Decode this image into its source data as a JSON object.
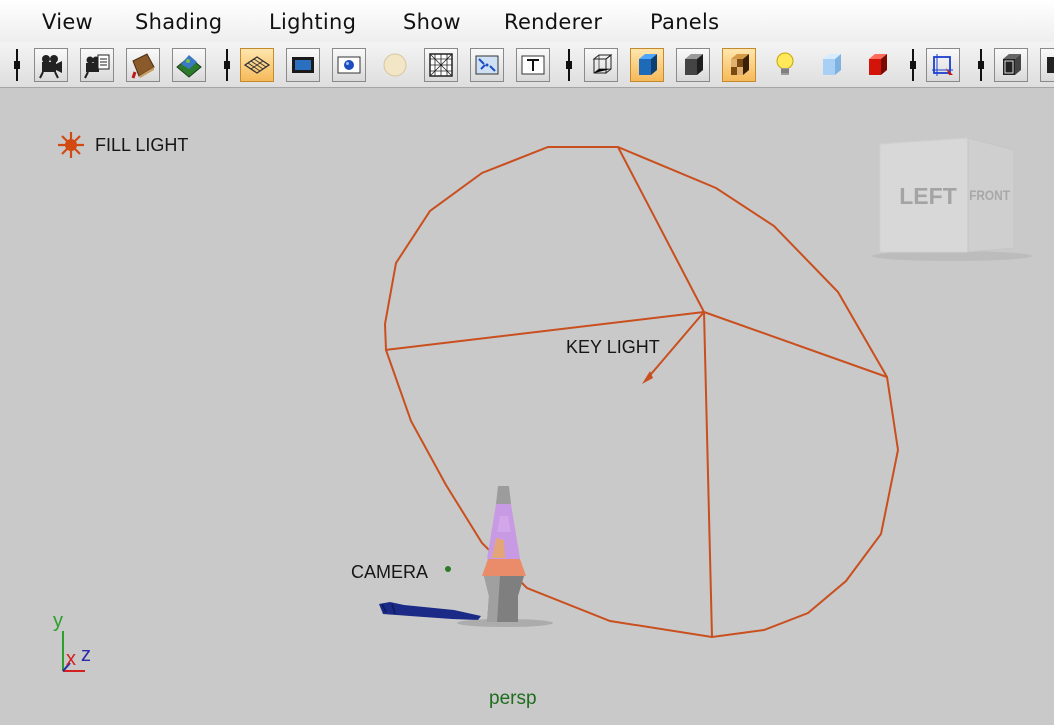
{
  "menu": {
    "items": [
      {
        "label": "View"
      },
      {
        "label": "Shading"
      },
      {
        "label": "Lighting"
      },
      {
        "label": "Show"
      },
      {
        "label": "Renderer"
      },
      {
        "label": "Panels"
      }
    ]
  },
  "toolbar": {
    "buttons": [
      {
        "name": "select-camera-icon",
        "active": false
      },
      {
        "name": "camera-attributes-icon",
        "active": false
      },
      {
        "name": "bookmarks-icon",
        "active": false
      },
      {
        "name": "image-plane-icon",
        "active": false
      },
      {
        "name": "grid-icon",
        "active": true
      },
      {
        "name": "film-gate-icon",
        "active": false
      },
      {
        "name": "resolution-gate-icon",
        "active": false
      },
      {
        "name": "gate-mask-icon",
        "active": false
      },
      {
        "name": "field-chart-icon",
        "active": false
      },
      {
        "name": "safe-action-icon",
        "active": false
      },
      {
        "name": "safe-title-icon",
        "active": false
      },
      {
        "name": "wireframe-icon",
        "active": false
      },
      {
        "name": "smooth-shade-icon",
        "active": true
      },
      {
        "name": "flat-shade-icon",
        "active": false
      },
      {
        "name": "textured-icon",
        "active": true
      },
      {
        "name": "lights-icon",
        "active": false
      },
      {
        "name": "shadows-icon",
        "active": false
      },
      {
        "name": "hardware-render-icon",
        "active": false
      },
      {
        "name": "isolate-select-icon",
        "active": false
      },
      {
        "name": "xray-icon",
        "active": false
      }
    ]
  },
  "viewport": {
    "fill_light_label": "FILL LIGHT",
    "key_light_label": "KEY LIGHT",
    "camera_label": "CAMERA",
    "view_name": "persp",
    "viewcube_face": "LEFT",
    "viewcube_side": "FRONT",
    "axis_labels": {
      "y": "y",
      "x": "x",
      "z": "z"
    }
  },
  "colors": {
    "light_wire": "#c94f1e",
    "viewport_bg": "#c9c9c9",
    "active_button": "#f6b95a",
    "view_name": "#1f6d1f",
    "axis_y": "#2ca02c",
    "axis_x": "#d62020",
    "axis_z": "#2a2aa8"
  }
}
